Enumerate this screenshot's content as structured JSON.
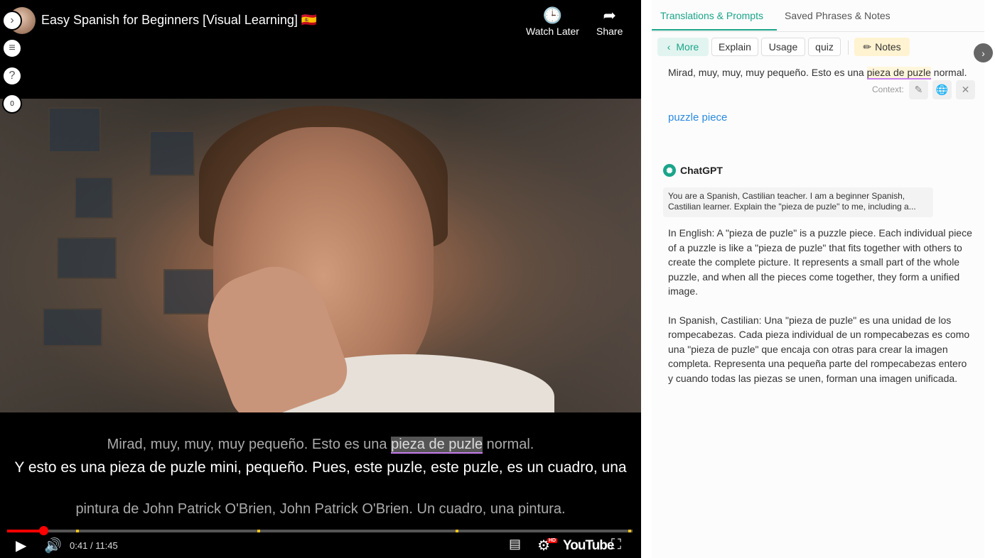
{
  "video": {
    "title": "Easy Spanish for Beginners [Visual Learning] 🇪🇸",
    "watch_later_label": "Watch Later",
    "share_label": "Share",
    "counter_badge": "0",
    "time_current": "0:41",
    "time_total": "11:45",
    "time_separator": "/",
    "progress_fraction": 0.058,
    "youtube_label": "YouTube",
    "hd_badge": "HD",
    "subtitles": {
      "prev_line_before": "Mirad, muy, muy, muy pequeño. Esto es una ",
      "prev_line_highlight": "pieza de puzle",
      "prev_line_after": " normal.",
      "current_line": "Y esto es una pieza de puzle mini, pequeño. Pues, este puzle, este puzle, es un cuadro, una",
      "next_line": "pintura de John Patrick O'Brien, John Patrick O'Brien. Un cuadro, una pintura."
    },
    "colors": {
      "progress": "#ff0000",
      "marker": "#f5c518",
      "highlight_underline": "#c87cf0"
    }
  },
  "panel": {
    "tabs": [
      {
        "label": "Translations & Prompts",
        "active": true
      },
      {
        "label": "Saved Phrases & Notes",
        "active": false
      }
    ],
    "chips": {
      "more": "More",
      "explain": "Explain",
      "usage": "Usage",
      "quiz": "quiz",
      "notes": "Notes"
    },
    "sentence_before": "Mirad, muy, muy, muy pequeño. Esto es una ",
    "sentence_highlight": "pieza de puzle",
    "sentence_after": " normal.",
    "context_label": "Context:",
    "translation": "puzzle piece",
    "gpt_name": "ChatGPT",
    "prompt_line1": "You are a Spanish, Castilian teacher. I am a beginner Spanish,",
    "prompt_line2": "Castilian learner. Explain the \"pieza de puzle\" to me, including a...",
    "answer_en": "In English: A \"pieza de puzle\" is a puzzle piece. Each individual piece of a puzzle is like a \"pieza de puzle\" that fits together with others to create the complete picture. It represents a small part of the whole puzzle, and when all the pieces come together, they form a unified image.",
    "answer_es": "In Spanish, Castilian: Una \"pieza de puzle\" es una unidad de los rompecabezas. Cada pieza individual de un rompecabezas es como una \"pieza de puzle\" que encaja con otras para crear la imagen completa. Representa una pequeña parte del rompecabezas entero y cuando todas las piezas se unen, forman una imagen unificada.",
    "colors": {
      "accent": "#1aa58a",
      "link": "#2b8be0",
      "notes_bg": "#fff3d1"
    }
  }
}
